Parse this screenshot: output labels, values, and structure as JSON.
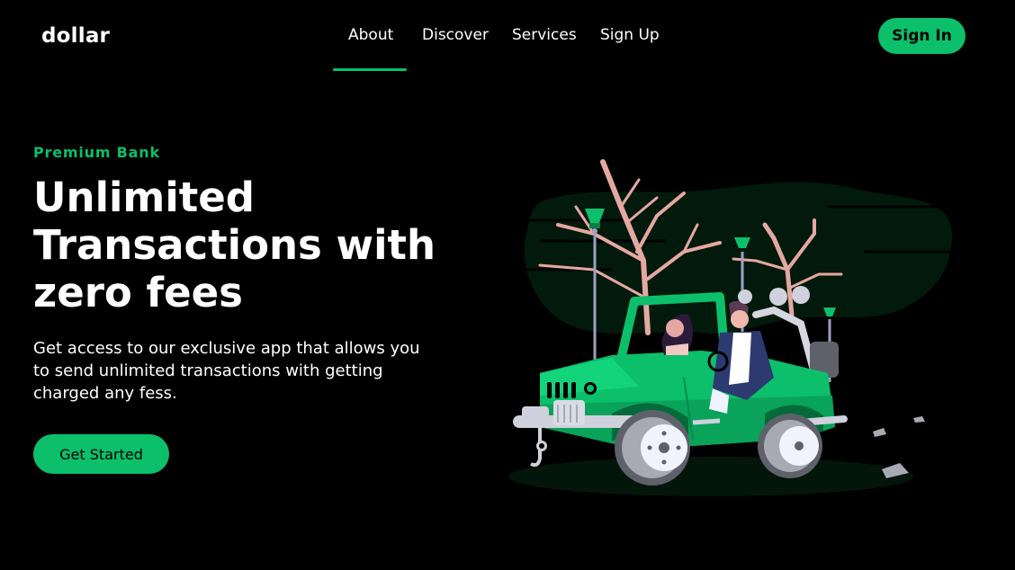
{
  "brand": {
    "name": "dollar"
  },
  "nav": {
    "items": [
      {
        "label": "About",
        "active": true
      },
      {
        "label": "Discover",
        "active": false
      },
      {
        "label": "Services",
        "active": false
      },
      {
        "label": "Sign Up",
        "active": false
      }
    ],
    "signin_label": "Sign In"
  },
  "hero": {
    "eyebrow": "Premium Bank",
    "headline": "Unlimited Transactions with zero fees",
    "description": "Get access to our exclusive app that allows you to send unlimited transactions with getting charged any fess.",
    "cta_label": "Get Started"
  },
  "theme": {
    "accent": "#0bbf6b",
    "background": "#000000",
    "text": "#ffffff"
  },
  "illustration": {
    "icon": "jeep-illustration"
  }
}
